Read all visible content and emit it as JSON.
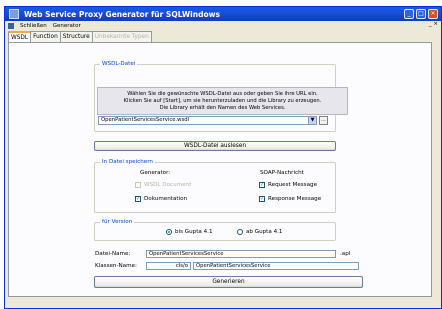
{
  "window": {
    "title": "Web Service Proxy Generator für SQLWindows"
  },
  "menu": {
    "items": [
      "Schließen",
      "Generator"
    ]
  },
  "tabs": [
    {
      "label": "WSDL",
      "state": "active"
    },
    {
      "label": "Function",
      "state": "normal"
    },
    {
      "label": "Structure",
      "state": "normal"
    },
    {
      "label": "Unbekannte Typen",
      "state": "disabled"
    }
  ],
  "wsdl_group": {
    "legend": "WSDL-Datei",
    "info_lines": [
      "Wählen Sie die gewünschte WSDL-Datei aus oder geben Sie ihre URL ein.",
      "Klicken Sie auf [Start], um sie herunterzuladen und die Library zu erzeugen.",
      "Die Library erhält den Namen des Web Services."
    ],
    "selected_file": "OpenPatientServicesService.wsdl",
    "browse_label": "...",
    "read_button": "WSDL-Datei auslesen"
  },
  "save_group": {
    "legend": "In Datei speichern",
    "generator_header": "Generator:",
    "soap_header": "SOAP-Nachricht",
    "options": [
      {
        "label": "WSDL Document",
        "checked": false,
        "disabled": true
      },
      {
        "label": "Dokumentation",
        "checked": true,
        "disabled": false
      },
      {
        "label": "Request Message",
        "checked": true,
        "disabled": false
      },
      {
        "label": "Response Message",
        "checked": true,
        "disabled": false
      }
    ]
  },
  "version_group": {
    "legend": "für Version",
    "options": [
      {
        "label": "bis Gupta 4.1",
        "selected": true
      },
      {
        "label": "ab Gupta 4.1",
        "selected": false
      }
    ]
  },
  "output": {
    "filename_label": "Datei-Name:",
    "filename_value": "OpenPatientServicesService",
    "filename_ext": ".apl",
    "classname_label": "Klassen-Name:",
    "classname_prefix": "cls/o",
    "classname_value": "OpenPatientServicesService",
    "generate_button": "Generieren"
  },
  "colors": {
    "titlebar": "#0a5fe6",
    "legend_text": "#0046d5",
    "checkmark": "#21a121",
    "panel": "#fcfcfe",
    "chrome": "#ece9d8"
  }
}
